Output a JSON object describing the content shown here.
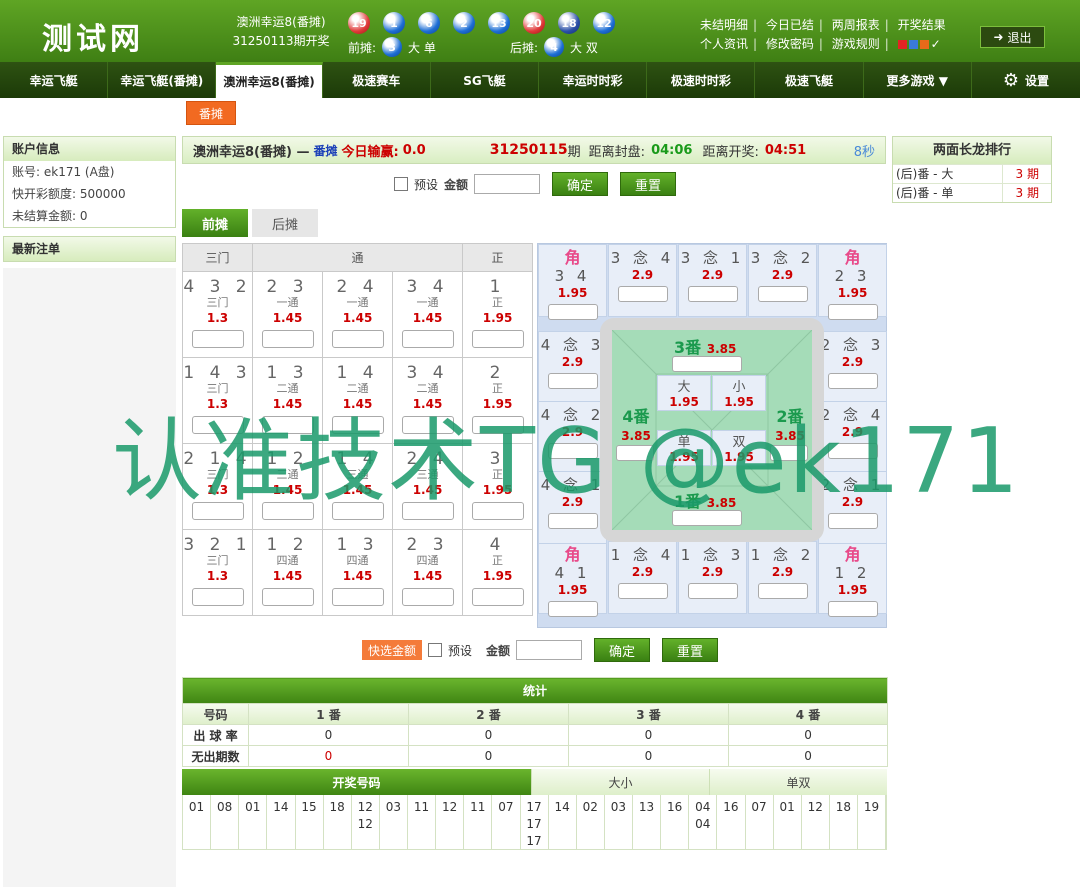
{
  "app": {
    "logo": "测试网"
  },
  "game": {
    "name": "澳洲幸运8(番摊)",
    "period_text": "31250113期开奖"
  },
  "draw": {
    "balls": [
      {
        "n": "19",
        "c": "red"
      },
      {
        "n": "1",
        "c": "blue"
      },
      {
        "n": "6",
        "c": "blue"
      },
      {
        "n": "2",
        "c": "blue"
      },
      {
        "n": "13",
        "c": "blue"
      },
      {
        "n": "20",
        "c": "red"
      },
      {
        "n": "18",
        "c": "dark"
      },
      {
        "n": "12",
        "c": "blue"
      }
    ],
    "front_label": "前摊:",
    "front_ball": "3",
    "front_text": "大 单",
    "back_label": "后摊:",
    "back_ball": "4",
    "back_text": "大 双"
  },
  "toplinks": {
    "row1": [
      "未结明细",
      "今日已结",
      "两周报表",
      "开奖结果"
    ],
    "row2": [
      "个人资讯",
      "修改密码",
      "游戏规则"
    ],
    "theme_colors": [
      "#e32424",
      "#3a7ad8",
      "#e86a1a"
    ],
    "check": "✓",
    "logout": "退出"
  },
  "nav": {
    "items": [
      "幸运飞艇",
      "幸运飞艇(番摊)",
      "澳洲幸运8(番摊)",
      "极速赛车",
      "SG飞艇",
      "幸运时时彩",
      "极速时时彩",
      "极速飞艇",
      "更多游戏 ▼"
    ],
    "active_index": 2,
    "settings": "设置"
  },
  "subtab": "番摊",
  "account": {
    "title": "账户信息",
    "rows": [
      "账号:   ek171 (A盘)",
      "快开彩额度:   500000",
      "未结算金额:   0"
    ],
    "recent": "最新注单"
  },
  "titlebar": {
    "game": "澳洲幸运8(番摊) —",
    "type": "番摊",
    "today_label": "今日输赢:",
    "today_value": "0.0",
    "period": "31250115",
    "period_suffix": "期",
    "close_label": "距离封盘:",
    "close_time": "04:06",
    "open_label": "距离开奖:",
    "open_time": "04:51",
    "countdown": "8秒"
  },
  "form": {
    "preset": "预设",
    "amount": "金额",
    "confirm": "确定",
    "reset": "重置",
    "quick": "快选金额"
  },
  "sidetabs": {
    "front": "前摊",
    "back": "后摊"
  },
  "table": {
    "headers": [
      "三门",
      "通",
      "正"
    ],
    "rows": [
      [
        {
          "n": "4 3 2",
          "s": "三门",
          "o": "1.3"
        },
        {
          "n": "2 3",
          "s": "一通",
          "o": "1.45"
        },
        {
          "n": "2 4",
          "s": "一通",
          "o": "1.45"
        },
        {
          "n": "3 4",
          "s": "一通",
          "o": "1.45"
        },
        {
          "n": "1",
          "s": "正",
          "o": "1.95"
        }
      ],
      [
        {
          "n": "1 4 3",
          "s": "三门",
          "o": "1.3"
        },
        {
          "n": "1 3",
          "s": "二通",
          "o": "1.45"
        },
        {
          "n": "1 4",
          "s": "二通",
          "o": "1.45"
        },
        {
          "n": "3 4",
          "s": "二通",
          "o": "1.45"
        },
        {
          "n": "2",
          "s": "正",
          "o": "1.95"
        }
      ],
      [
        {
          "n": "2 1 4",
          "s": "三门",
          "o": "1.3"
        },
        {
          "n": "1 2",
          "s": "三通",
          "o": "1.45"
        },
        {
          "n": "1 4",
          "s": "三通",
          "o": "1.45"
        },
        {
          "n": "2 4",
          "s": "三通",
          "o": "1.45"
        },
        {
          "n": "3",
          "s": "正",
          "o": "1.95"
        }
      ],
      [
        {
          "n": "3 2 1",
          "s": "三门",
          "o": "1.3"
        },
        {
          "n": "1 2",
          "s": "四通",
          "o": "1.45"
        },
        {
          "n": "1 3",
          "s": "四通",
          "o": "1.45"
        },
        {
          "n": "2 3",
          "s": "四通",
          "o": "1.45"
        },
        {
          "n": "4",
          "s": "正",
          "o": "1.95"
        }
      ]
    ]
  },
  "board": {
    "jiao": "角",
    "top": [
      {
        "t": "3 4",
        "o": "1.95",
        "j": true
      },
      {
        "t": "3 念 4",
        "o": "2.9"
      },
      {
        "t": "3 念 1",
        "o": "2.9"
      },
      {
        "t": "3 念 2",
        "o": "2.9"
      },
      {
        "t": "2 3",
        "o": "1.95",
        "j": true
      }
    ],
    "bottom": [
      {
        "t": "4 1",
        "o": "1.95",
        "j": true
      },
      {
        "t": "1 念 4",
        "o": "2.9"
      },
      {
        "t": "1 念 3",
        "o": "2.9"
      },
      {
        "t": "1 念 2",
        "o": "2.9"
      },
      {
        "t": "1 2",
        "o": "1.95",
        "j": true
      }
    ],
    "left": [
      {
        "t": "4 念 3",
        "o": "2.9"
      },
      {
        "t": "4 念 2",
        "o": "2.9"
      },
      {
        "t": "4 念 1",
        "o": "2.9"
      }
    ],
    "right": [
      {
        "t": "2 念 3",
        "o": "2.9"
      },
      {
        "t": "2 念 4",
        "o": "2.9"
      },
      {
        "t": "2 念 1",
        "o": "2.9"
      }
    ],
    "fan3": "3番",
    "fan3_o": "3.85",
    "fan4": "4番",
    "fan4_o": "3.85",
    "fan2": "2番",
    "fan2_o": "3.85",
    "fan1": "1番",
    "fan1_o": "3.85",
    "big": "大",
    "big_o": "1.95",
    "small": "小",
    "small_o": "1.95",
    "odd": "单",
    "odd_o": "1.95",
    "even": "双",
    "even_o": "1.95"
  },
  "stats": {
    "title": "统计",
    "cols": [
      "号码",
      "1 番",
      "2 番",
      "3 番",
      "4 番"
    ],
    "rows": [
      [
        "出 球 率",
        "0",
        "0",
        "0",
        "0"
      ],
      [
        "无出期数",
        "0",
        "0",
        "0",
        "0"
      ]
    ]
  },
  "draws": {
    "tabs": [
      "开奖号码",
      "大小",
      "单双"
    ],
    "cells": [
      "01",
      "08",
      "01",
      "14",
      "15",
      "18",
      "12\n12",
      "03",
      "11",
      "12",
      "11",
      "07",
      "17\n17\n17",
      "14",
      "02",
      "03",
      "13",
      "16",
      "04\n04",
      "16",
      "07",
      "01",
      "12",
      "18",
      "19"
    ]
  },
  "dragon": {
    "title": "两面长龙排行",
    "rows": [
      {
        "name": "(后)番 - 大",
        "val": "3 期"
      },
      {
        "name": "(后)番 - 单",
        "val": "3 期"
      }
    ]
  },
  "watermark": "认准技术TG @ek171"
}
